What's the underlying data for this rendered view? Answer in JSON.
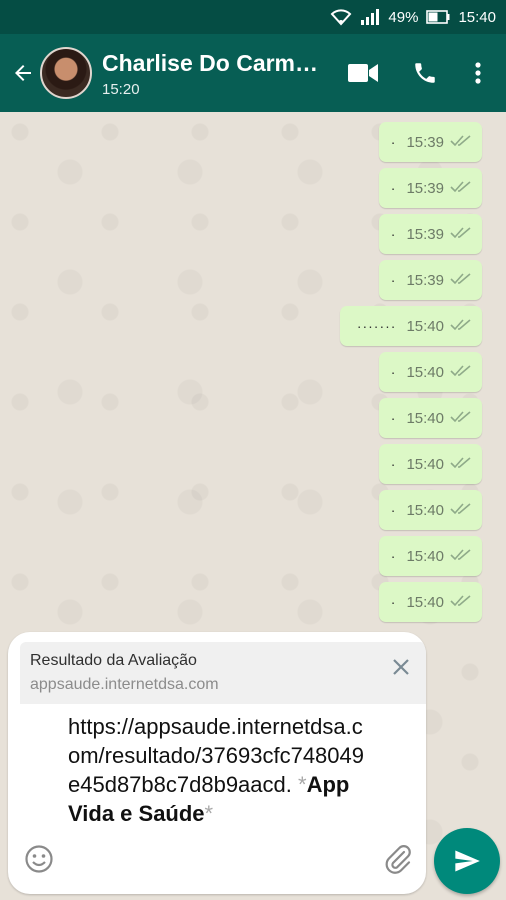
{
  "status_bar": {
    "battery": "49%",
    "time": "15:40",
    "icons": [
      "wifi-icon",
      "signal-icon",
      "battery-icon"
    ]
  },
  "header": {
    "contact_name": "Charlise Do Carm…",
    "last_seen": "15:20",
    "icons": [
      "back-arrow-icon",
      "video-call-icon",
      "phone-icon",
      "more-vert-icon"
    ]
  },
  "messages": [
    {
      "text": "·",
      "time": "15:39"
    },
    {
      "text": "·",
      "time": "15:39"
    },
    {
      "text": "·",
      "time": "15:39"
    },
    {
      "text": "·",
      "time": "15:39"
    },
    {
      "text": "·······",
      "time": "15:40"
    },
    {
      "text": "·",
      "time": "15:40"
    },
    {
      "text": "·",
      "time": "15:40"
    },
    {
      "text": "·",
      "time": "15:40"
    },
    {
      "text": "·",
      "time": "15:40"
    },
    {
      "text": "·",
      "time": "15:40"
    },
    {
      "text": "·",
      "time": "15:40"
    }
  ],
  "compose": {
    "preview_title": "Resultado da Avaliação",
    "preview_url": "appsaude.internetdsa.com",
    "text_link": "https://appsaude.internetdsa.com/resultado/37693cfc748049e45d87b8c7d8b9aacd.",
    "star_open": " *",
    "bold_text": "App Vida e Saúde",
    "star_close": "*"
  },
  "colors": {
    "header": "#075e54",
    "status_bar": "#054d44",
    "bubble_out": "#dcf8c6",
    "send_button": "#00897b",
    "read_ticks": "#8faa89"
  }
}
